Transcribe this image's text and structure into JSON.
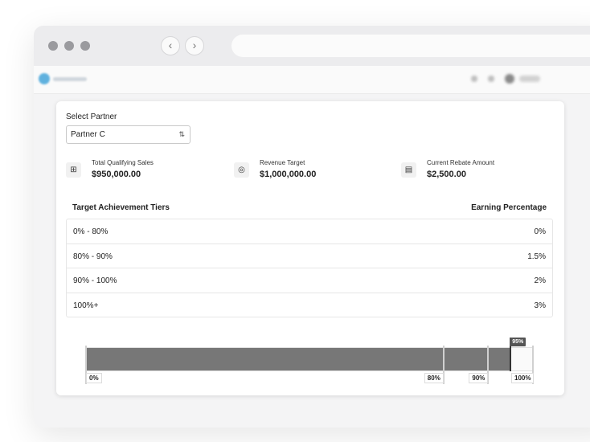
{
  "partner": {
    "label": "Select Partner",
    "selected": "Partner C"
  },
  "stats": [
    {
      "icon": "table-icon",
      "title": "Total Qualifying Sales",
      "value": "$950,000.00"
    },
    {
      "icon": "target-icon",
      "title": "Revenue Target",
      "value": "$1,000,000.00"
    },
    {
      "icon": "receipt-icon",
      "title": "Current Rebate Amount",
      "value": "$2,500.00"
    }
  ],
  "tiers": {
    "header_left": "Target Achievement Tiers",
    "header_right": "Earning Percentage",
    "rows": [
      {
        "range": "0% - 80%",
        "percent": "0%"
      },
      {
        "range": "80% - 90%",
        "percent": "1.5%"
      },
      {
        "range": "90% - 100%",
        "percent": "2%"
      },
      {
        "range": "100%+",
        "percent": "3%"
      }
    ]
  },
  "progress": {
    "current_value": 95,
    "current_label": "95%",
    "max": 100,
    "markers": [
      {
        "value": 0,
        "label": "0%"
      },
      {
        "value": 80,
        "label": "80%"
      },
      {
        "value": 90,
        "label": "90%"
      },
      {
        "value": 100,
        "label": "100%"
      }
    ]
  },
  "colors": {
    "fill": "#777777",
    "current_marker": "#555555"
  }
}
